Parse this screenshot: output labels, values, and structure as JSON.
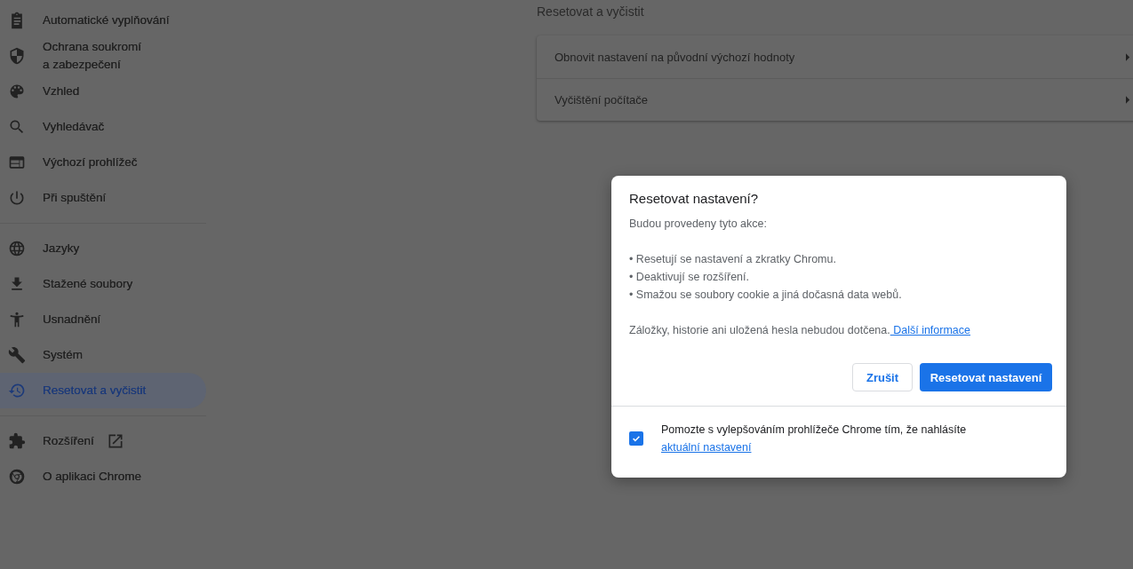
{
  "sidebar": {
    "groups": [
      {
        "items": [
          {
            "label": "Automatické vyplňování",
            "selected": false
          },
          {
            "label": "Ochrana soukromí\na zabezpečení",
            "selected": false
          },
          {
            "label": "Vzhled",
            "selected": false
          },
          {
            "label": "Vyhledávač",
            "selected": false
          },
          {
            "label": "Výchozí prohlížeč",
            "selected": false
          },
          {
            "label": "Při spuštění",
            "selected": false
          }
        ]
      },
      {
        "items": [
          {
            "label": "Jazyky",
            "selected": false
          },
          {
            "label": "Stažené soubory",
            "selected": false
          },
          {
            "label": "Usnadnění",
            "selected": false
          },
          {
            "label": "Systém",
            "selected": false
          },
          {
            "label": "Resetovat a vyčistit",
            "selected": true
          }
        ]
      },
      {
        "items": [
          {
            "label": "Rozšíření",
            "selected": false,
            "external": true
          },
          {
            "label": "O aplikaci Chrome",
            "selected": false
          }
        ]
      }
    ]
  },
  "main": {
    "heading": "Resetovat a vyčistit",
    "rows": [
      {
        "label": "Obnovit nastavení na původní výchozí hodnoty"
      },
      {
        "label": "Vyčištění počítače"
      }
    ]
  },
  "dialog": {
    "title": "Resetovat nastavení?",
    "intro": "Budou provedeny tyto akce:",
    "bullets": [
      "• Resetují se nastavení a zkratky Chromu.",
      "• Deaktivují se rozšíření.",
      "• Smažou se soubory cookie a jiná dočasná data webů."
    ],
    "note": "Záložky, historie ani uložená hesla nebudou dotčena.",
    "note_link": " Další informace",
    "buttons": [
      {
        "label": "Zrušit",
        "kind": "secondary"
      },
      {
        "label": "Resetovat nastavení",
        "kind": "primary"
      }
    ],
    "footer": {
      "checked": true,
      "text": "Pomozte s vylepšováním prohlížeče Chrome tím, že nahlásíte",
      "link": "aktuální nastavení"
    }
  }
}
